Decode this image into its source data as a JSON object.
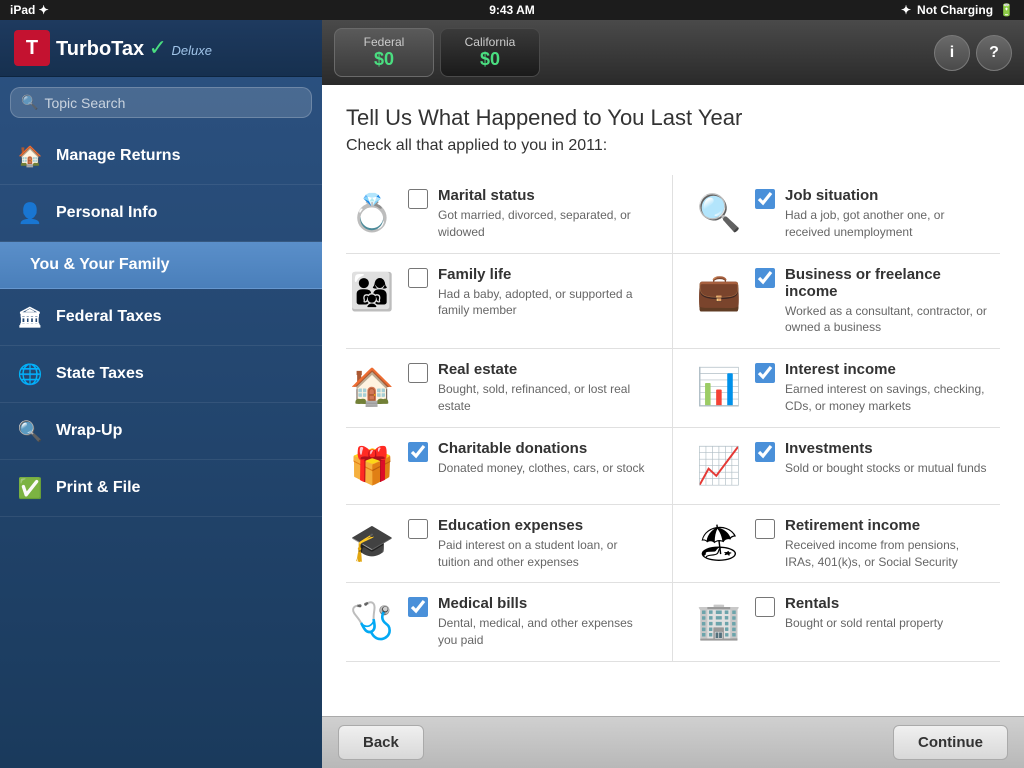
{
  "status_bar": {
    "left": "iPad ✦",
    "center": "9:43 AM",
    "right_bluetooth": "✦",
    "right_label": "Not Charging"
  },
  "sidebar": {
    "logo_text": "TurboTax",
    "logo_deluxe": "Deluxe",
    "search_placeholder": "Topic Search",
    "nav_items": [
      {
        "id": "manage-returns",
        "label": "Manage Returns",
        "icon": "🏠"
      },
      {
        "id": "personal-info",
        "label": "Personal Info",
        "icon": "👤"
      },
      {
        "id": "you-family",
        "label": "You & Your Family",
        "icon": "",
        "sub": true
      },
      {
        "id": "federal-taxes",
        "label": "Federal Taxes",
        "icon": "🏛"
      },
      {
        "id": "state-taxes",
        "label": "State Taxes",
        "icon": "🌐"
      },
      {
        "id": "wrap-up",
        "label": "Wrap-Up",
        "icon": "🔍"
      },
      {
        "id": "print-file",
        "label": "Print & File",
        "icon": "✅"
      }
    ]
  },
  "top_bar": {
    "federal_label": "Federal",
    "federal_amount": "$0",
    "california_label": "California",
    "california_amount": "$0",
    "info_label": "i",
    "help_label": "?"
  },
  "main": {
    "title": "Tell Us What Happened to You Last Year",
    "subtitle": "Check all that applied to you in 2011:",
    "items": [
      {
        "id": "marital-status",
        "title": "Marital status",
        "desc": "Got married, divorced, separated, or widowed",
        "icon": "💍",
        "checked": false,
        "col": "left"
      },
      {
        "id": "job-situation",
        "title": "Job situation",
        "desc": "Had a job, got another one, or received unemployment",
        "icon": "🔍",
        "checked": true,
        "col": "right"
      },
      {
        "id": "family-life",
        "title": "Family life",
        "desc": "Had a baby, adopted, or supported a family member",
        "icon": "👨‍👩‍👧",
        "checked": false,
        "col": "left"
      },
      {
        "id": "business-freelance",
        "title": "Business or freelance income",
        "desc": "Worked as a consultant, contractor, or owned a business",
        "icon": "💼",
        "checked": true,
        "col": "right"
      },
      {
        "id": "real-estate",
        "title": "Real estate",
        "desc": "Bought, sold, refinanced, or lost real estate",
        "icon": "🏠",
        "checked": false,
        "col": "left"
      },
      {
        "id": "interest-income",
        "title": "Interest income",
        "desc": "Earned interest on savings, checking, CDs, or money markets",
        "icon": "📊",
        "checked": true,
        "col": "right"
      },
      {
        "id": "charitable-donations",
        "title": "Charitable donations",
        "desc": "Donated money, clothes, cars, or stock",
        "icon": "🎁",
        "checked": true,
        "col": "left"
      },
      {
        "id": "investments",
        "title": "Investments",
        "desc": "Sold or bought stocks or mutual funds",
        "icon": "📈",
        "checked": true,
        "col": "right"
      },
      {
        "id": "education-expenses",
        "title": "Education expenses",
        "desc": "Paid interest on a student loan, or tuition and other expenses",
        "icon": "🎓",
        "checked": false,
        "col": "left"
      },
      {
        "id": "retirement-income",
        "title": "Retirement income",
        "desc": "Received income from pensions, IRAs, 401(k)s, or Social Security",
        "icon": "🏖",
        "checked": false,
        "col": "right"
      },
      {
        "id": "medical-bills",
        "title": "Medical bills",
        "desc": "Dental, medical, and other expenses you paid",
        "icon": "🩺",
        "checked": true,
        "col": "left"
      },
      {
        "id": "rentals",
        "title": "Rentals",
        "desc": "Bought or sold rental property",
        "icon": "🏢",
        "checked": false,
        "col": "right"
      }
    ]
  },
  "bottom_bar": {
    "back_label": "Back",
    "continue_label": "Continue"
  }
}
